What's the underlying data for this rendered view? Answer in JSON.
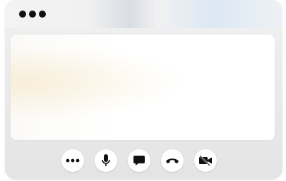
{
  "window": {
    "title_menu_icon": "more-dots-icon"
  },
  "controls": [
    {
      "name": "more-options-button",
      "icon": "ellipsis-icon"
    },
    {
      "name": "microphone-button",
      "icon": "microphone-icon"
    },
    {
      "name": "chat-button",
      "icon": "chat-bubble-icon"
    },
    {
      "name": "end-call-button",
      "icon": "phone-hangup-icon"
    },
    {
      "name": "camera-off-button",
      "icon": "video-off-icon"
    }
  ],
  "colors": {
    "icon": "#111111",
    "button_bg": "#ffffff"
  }
}
